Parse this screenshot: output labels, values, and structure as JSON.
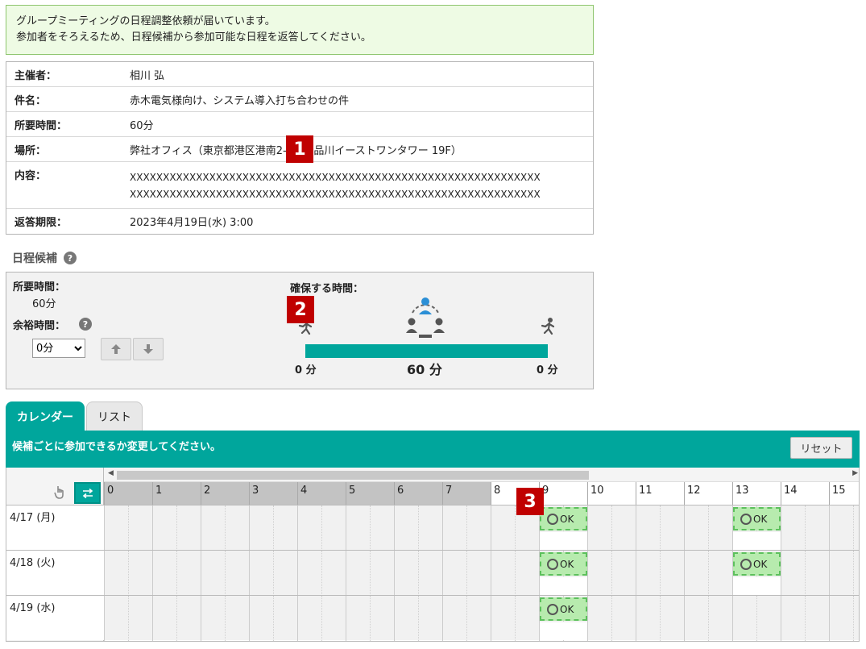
{
  "notice": {
    "line1": "グループミーティングの日程調整依頼が届いています。",
    "line2": "参加者をそろえるため、日程候補から参加可能な日程を返答してください。"
  },
  "info": {
    "organizer_label": "主催者：",
    "organizer": "相川 弘",
    "subject_label": "件名：",
    "subject": "赤木電気様向け、システム導入打ち合わせの件",
    "duration_label": "所要時間：",
    "duration": "60分",
    "place_label": "場所：",
    "place": "弊社オフィス（東京都港区港南2-16-1 品川イーストワンタワー 19F）",
    "content_label": "内容：",
    "content_line1": "XXXXXXXXXXXXXXXXXXXXXXXXXXXXXXXXXXXXXXXXXXXXXXXXXXXXXXXXXXXXXX",
    "content_line2": "XXXXXXXXXXXXXXXXXXXXXXXXXXXXXXXXXXXXXXXXXXXXXXXXXXXXXXXXXXXXXX",
    "deadline_label": "返答期限：",
    "deadline": "2023年4月19日(水) 3:00"
  },
  "markers": [
    "1",
    "2",
    "3"
  ],
  "schedule": {
    "title": "日程候補",
    "help_icon": "?",
    "duration_label": "所要時間：",
    "duration_value": "60分",
    "margin_label": "余裕時間：",
    "margin_select": "0分",
    "secure_label": "確保する時間：",
    "before_minutes": "0 分",
    "meeting_minutes": "60 分",
    "after_minutes": "0 分"
  },
  "tabs": {
    "calendar": "カレンダー",
    "list": "リスト"
  },
  "band": {
    "message": "候補ごとに参加できるか変更してください。",
    "reset": "リセット"
  },
  "hours": [
    "0",
    "1",
    "2",
    "3",
    "4",
    "5",
    "6",
    "7",
    "8",
    "9",
    "10",
    "11",
    "12",
    "13",
    "14",
    "15"
  ],
  "days": [
    {
      "label": "4/17 (月)",
      "ok": [
        "9",
        "13"
      ]
    },
    {
      "label": "4/18 (火)",
      "ok": [
        "9",
        "13"
      ]
    },
    {
      "label": "4/19 (水)",
      "ok": [
        "9"
      ]
    }
  ],
  "ok_text": "OK",
  "colors": {
    "accent": "#00a69c",
    "ok_fill": "#b7ebae",
    "marker": "#c00000"
  }
}
